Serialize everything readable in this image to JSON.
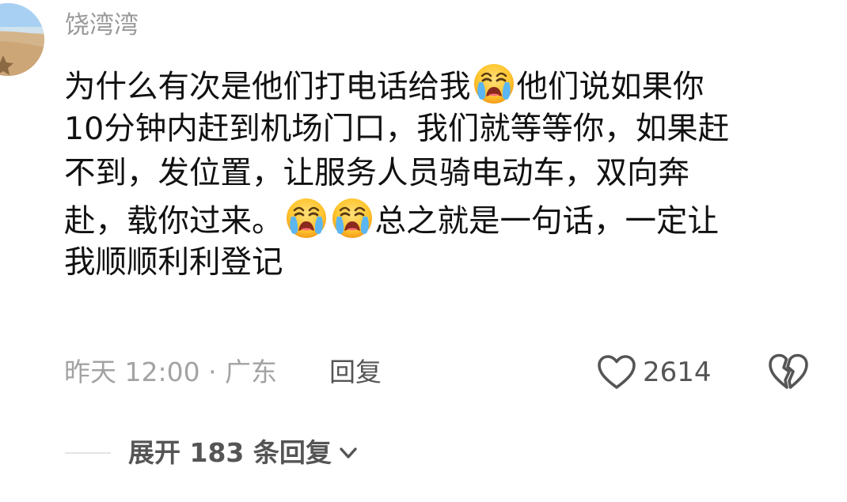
{
  "comment": {
    "author": {
      "name": "饶湾湾",
      "avatar_icon": "beach-photo-avatar"
    },
    "text_lines": [
      [
        "为什么有次是他们打电话给我",
        "[cry]",
        "他们说如果你"
      ],
      [
        "10分钟内赶到机场门口，我们就等等你，如果赶"
      ],
      [
        "不到，发位置，让服务人员骑电动车，双向奔"
      ],
      [
        "赴，载你过来。",
        "[cry]",
        "[cry]",
        "总之就是一句话，一定让"
      ],
      [
        "我顺顺利利登记"
      ]
    ],
    "emoji_icon": "loudly-crying-face-emoji",
    "meta": {
      "time_location": "昨天 12:00 · 广东",
      "reply_label": "回复",
      "like_icon": "heart-outline-icon",
      "like_count": "2614",
      "dislike_icon": "broken-heart-icon"
    },
    "expand": {
      "label": "展开 183 条回复",
      "icon": "chevron-down-icon"
    }
  },
  "colors": {
    "text": "#111111",
    "muted": "#a3a3a3",
    "secondary": "#555555",
    "background": "#ffffff"
  }
}
